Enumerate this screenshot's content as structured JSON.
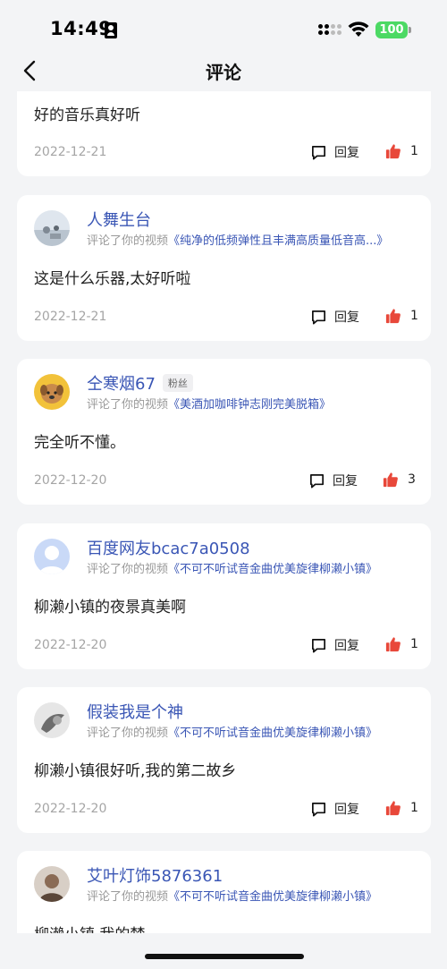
{
  "status_bar": {
    "time": "14:49",
    "battery": "100"
  },
  "nav": {
    "title": "评论"
  },
  "labels": {
    "reply": "回复",
    "commented_video": "评论了你的视频"
  },
  "colors": {
    "link": "#3a56b5",
    "like": "#e8483a",
    "battery": "#4cd964"
  },
  "comments": [
    {
      "text": "好的音乐真好听",
      "date": "2022-12-21",
      "likes": "1"
    },
    {
      "user": "人舞生台",
      "video": "《纯净的低频弹性且丰满高质量低音高...》",
      "text": "这是什么乐器,太好听啦",
      "date": "2022-12-21",
      "likes": "1",
      "avatar": "stage-photo"
    },
    {
      "user": "仝寒烟67",
      "badge": "粉丝",
      "video": "《美酒加咖啡钟志刚完美脱箱》",
      "text": "完全听不懂。",
      "date": "2022-12-20",
      "likes": "3",
      "avatar": "puppy-photo"
    },
    {
      "user": "百度网友bcac7a0508",
      "video": "《不可不听试音金曲优美旋律柳濑小镇》",
      "text": "柳濑小镇的夜景真美啊",
      "date": "2022-12-20",
      "likes": "1",
      "avatar": "default-avatar"
    },
    {
      "user": "假装我是个神",
      "video": "《不可不听试音金曲优美旋律柳濑小镇》",
      "text": "柳濑小镇很好听,我的第二故乡",
      "date": "2022-12-20",
      "likes": "1",
      "avatar": "sketch-photo"
    },
    {
      "user": "艾叶灯饰5876361",
      "video": "《不可不听试音金曲优美旋律柳濑小镇》",
      "text": "柳濑小镇 我的梦",
      "avatar": "portrait-photo"
    }
  ]
}
